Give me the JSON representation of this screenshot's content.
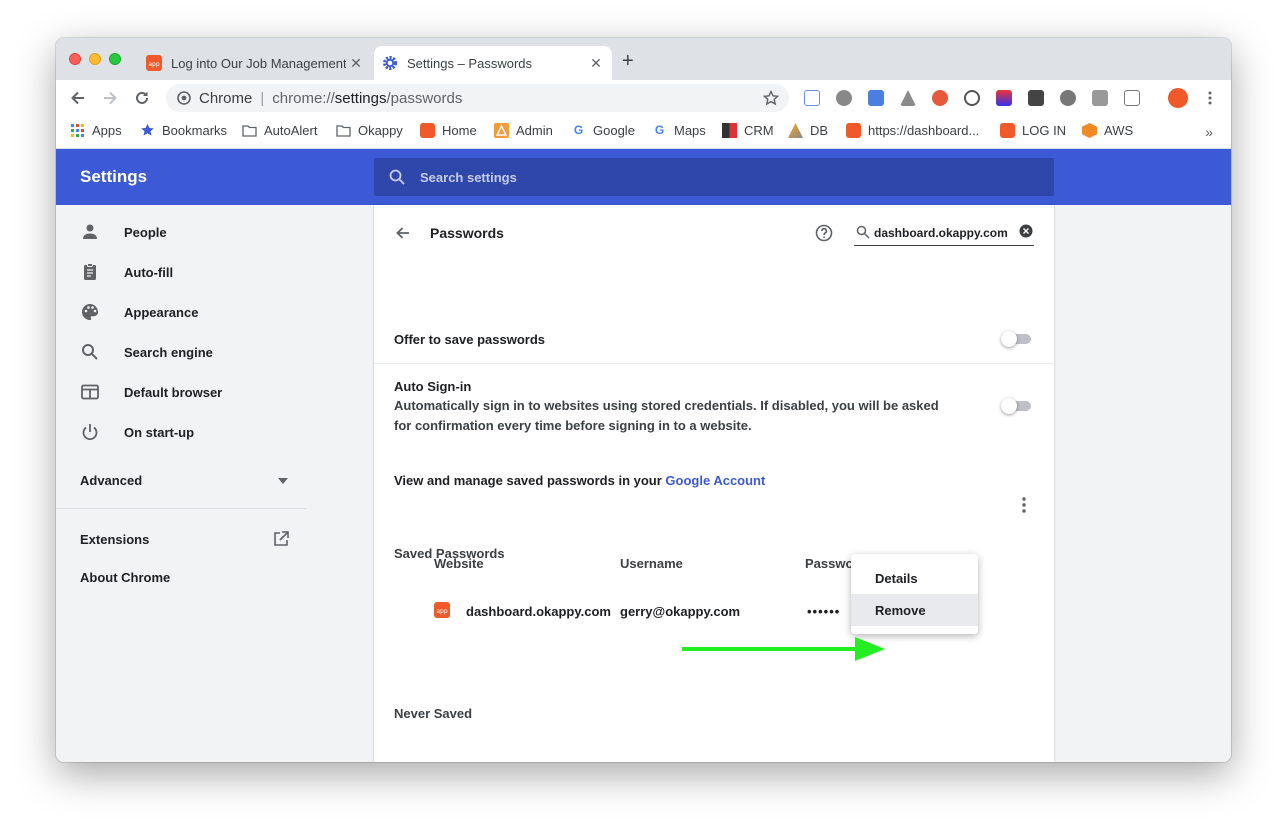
{
  "tabs": [
    {
      "title": "Log into Our Job Management",
      "active": false
    },
    {
      "title": "Settings – Passwords",
      "active": true
    }
  ],
  "omnibox": {
    "chip": "Chrome",
    "separator": "|",
    "url_prefix": "chrome://",
    "url_host": "settings",
    "url_path": "/passwords"
  },
  "bookmarks": [
    {
      "label": "Apps",
      "icon": "apps-grid-icon"
    },
    {
      "label": "Bookmarks",
      "icon": "star-icon"
    },
    {
      "label": "AutoAlert",
      "icon": "folder-icon"
    },
    {
      "label": "Okappy",
      "icon": "folder-icon"
    },
    {
      "label": "Home",
      "icon": "app-icon"
    },
    {
      "label": "Admin",
      "icon": "admin-icon"
    },
    {
      "label": "Google",
      "icon": "google-icon"
    },
    {
      "label": "Maps",
      "icon": "google-icon"
    },
    {
      "label": "CRM",
      "icon": "crm-icon"
    },
    {
      "label": "DB",
      "icon": "pma-icon"
    },
    {
      "label": "https://dashboard...",
      "icon": "app-icon"
    },
    {
      "label": "LOG IN",
      "icon": "app-icon"
    },
    {
      "label": "AWS",
      "icon": "aws-icon"
    }
  ],
  "bookmarks_more": "»",
  "header": {
    "title": "Settings",
    "search_placeholder": "Search settings"
  },
  "sidebar": {
    "items": [
      {
        "label": "People",
        "icon": "person-icon"
      },
      {
        "label": "Auto-fill",
        "icon": "clipboard-icon"
      },
      {
        "label": "Appearance",
        "icon": "palette-icon"
      },
      {
        "label": "Search engine",
        "icon": "search-icon"
      },
      {
        "label": "Default browser",
        "icon": "browser-window-icon"
      },
      {
        "label": "On start-up",
        "icon": "power-icon"
      }
    ],
    "advanced": "Advanced",
    "extensions": "Extensions",
    "about": "About Chrome"
  },
  "passwords": {
    "title": "Passwords",
    "search_value": "dashboard.okappy.com",
    "offer_to_save": "Offer to save passwords",
    "offer_to_save_enabled": false,
    "auto_signin_title": "Auto Sign-in",
    "auto_signin_desc": "Automatically sign in to websites using stored credentials. If disabled, you will be asked for confirmation every time before signing in to a website.",
    "auto_signin_enabled": false,
    "manage_text": "View and manage saved passwords in your ",
    "manage_link": "Google Account",
    "saved_heading": "Saved Passwords",
    "columns": {
      "website": "Website",
      "username": "Username",
      "password": "Password"
    },
    "entries": [
      {
        "website": "dashboard.okappy.com",
        "username": "gerry@okappy.com",
        "password": "••••••"
      }
    ],
    "never_saved_heading": "Never Saved"
  },
  "context_menu": {
    "items": [
      "Details",
      "Remove"
    ],
    "highlighted": "Remove"
  },
  "colors": {
    "header_blue": "#3c5ad6",
    "link": "#3c5ad6",
    "annotation_arrow": "#22ee22"
  }
}
